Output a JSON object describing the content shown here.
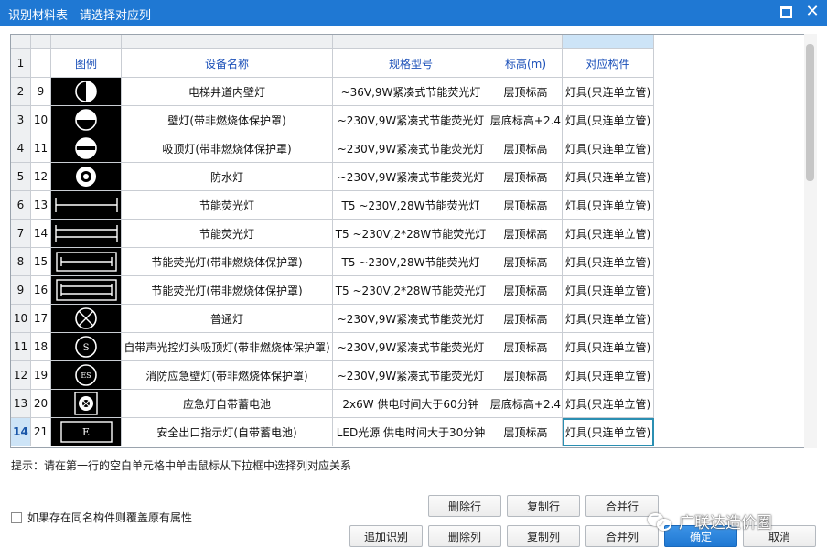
{
  "window": {
    "title": "识别材料表—请选择对应列"
  },
  "table": {
    "header": {
      "row_number": "1",
      "legend": "图例",
      "device_name": "设备名称",
      "spec_model": "规格型号",
      "elevation": "标高(m)",
      "component": "对应构件"
    },
    "selected_row_number": "14",
    "rows": [
      {
        "row_number": "2",
        "seq": "9",
        "legend_icon": "half-filled-circle-icon",
        "device_name": "电梯井道内壁灯",
        "spec_model": "~36V,9W紧凑式节能荧光灯",
        "elevation": "层顶标高",
        "component": "灯具(只连单立管)"
      },
      {
        "row_number": "3",
        "seq": "10",
        "legend_icon": "bottom-half-circle-icon",
        "device_name": "壁灯(带非燃烧体保护罩)",
        "spec_model": "~230V,9W紧凑式节能荧光灯",
        "elevation": "层底标高+2.4",
        "component": "灯具(只连单立管)"
      },
      {
        "row_number": "4",
        "seq": "11",
        "legend_icon": "ceiling-lamp-circle-icon",
        "device_name": "吸顶灯(带非燃烧体保护罩)",
        "spec_model": "~230V,9W紧凑式节能荧光灯",
        "elevation": "层顶标高",
        "component": "灯具(只连单立管)"
      },
      {
        "row_number": "5",
        "seq": "12",
        "legend_icon": "waterproof-lamp-icon",
        "device_name": "防水灯",
        "spec_model": "~230V,9W紧凑式节能荧光灯",
        "elevation": "层顶标高",
        "component": "灯具(只连单立管)"
      },
      {
        "row_number": "6",
        "seq": "13",
        "legend_icon": "single-fluorescent-tube-icon",
        "device_name": "节能荧光灯",
        "spec_model": "T5  ~230V,28W节能荧光灯",
        "elevation": "层顶标高",
        "component": "灯具(只连单立管)"
      },
      {
        "row_number": "7",
        "seq": "14",
        "legend_icon": "double-fluorescent-tube-icon",
        "device_name": "节能荧光灯",
        "spec_model": "T5  ~230V,2*28W节能荧光灯",
        "elevation": "层顶标高",
        "component": "灯具(只连单立管)"
      },
      {
        "row_number": "8",
        "seq": "15",
        "legend_icon": "boxed-single-tube-icon",
        "device_name": "节能荧光灯(带非燃烧体保护罩)",
        "spec_model": "T5  ~230V,28W节能荧光灯",
        "elevation": "层顶标高",
        "component": "灯具(只连单立管)"
      },
      {
        "row_number": "9",
        "seq": "16",
        "legend_icon": "boxed-double-tube-icon",
        "device_name": "节能荧光灯(带非燃烧体保护罩)",
        "spec_model": "T5  ~230V,2*28W节能荧光灯",
        "elevation": "层顶标高",
        "component": "灯具(只连单立管)"
      },
      {
        "row_number": "10",
        "seq": "17",
        "legend_icon": "cross-circle-lamp-icon",
        "device_name": "普通灯",
        "spec_model": "~230V,9W紧凑式节能荧光灯",
        "elevation": "层顶标高",
        "component": "灯具(只连单立管)"
      },
      {
        "row_number": "11",
        "seq": "18",
        "legend_icon": "circle-s-icon",
        "device_name": "自带声光控灯头吸顶灯(带非燃烧体保护罩)",
        "spec_model": "~230V,9W紧凑式节能荧光灯",
        "elevation": "层顶标高",
        "component": "灯具(只连单立管)"
      },
      {
        "row_number": "12",
        "seq": "19",
        "legend_icon": "circle-es-icon",
        "device_name": "消防应急壁灯(带非燃烧体保护罩)",
        "spec_model": "~230V,9W紧凑式节能荧光灯",
        "elevation": "层顶标高",
        "component": "灯具(只连单立管)"
      },
      {
        "row_number": "13",
        "seq": "20",
        "legend_icon": "emergency-battery-lamp-icon",
        "device_name": "应急灯自带蓄电池",
        "spec_model": "2x6W  供电时间大于60分钟",
        "elevation": "层底标高+2.4",
        "component": "灯具(只连单立管)"
      },
      {
        "row_number": "14",
        "seq": "21",
        "legend_icon": "exit-sign-e-icon",
        "device_name": "安全出口指示灯(自带蓄电池)",
        "spec_model": "LED光源  供电时间大于30分钟",
        "elevation": "层顶标高",
        "component": "灯具(只连单立管)"
      }
    ]
  },
  "hint": "提示：请在第一行的空白单元格中单击鼠标从下拉框中选择列对应关系",
  "overwrite_checkbox": {
    "label": "如果存在同名构件则覆盖原有属性",
    "checked": false
  },
  "buttons": {
    "delete_row": "删除行",
    "copy_row": "复制行",
    "merge_row": "合并行",
    "add_recognition": "追加识别",
    "delete_column": "删除列",
    "copy_column": "复制列",
    "merge_column": "合并列",
    "confirm": "确定",
    "cancel": "取消"
  },
  "watermark": "广联达造价圈",
  "colors": {
    "titlebar": "#1f78d3",
    "header_text": "#1a4fb8",
    "selection": "#cde4f7",
    "active_cell": "#2b8fb2"
  }
}
